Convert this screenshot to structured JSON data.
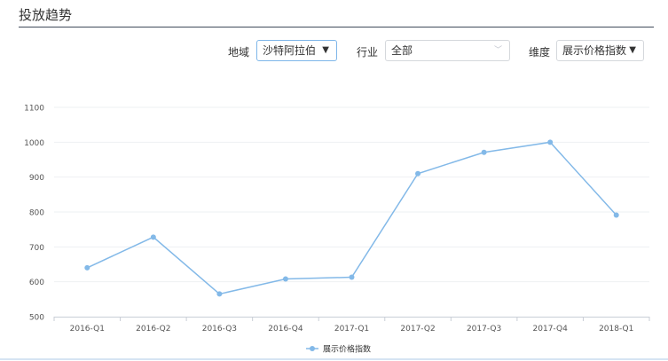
{
  "panel": {
    "title": "投放趋势"
  },
  "filters": {
    "region": {
      "label": "地域",
      "value": "沙特阿拉伯"
    },
    "industry": {
      "label": "行业",
      "value": "全部"
    },
    "dimension": {
      "label": "维度",
      "value": "展示价格指数"
    }
  },
  "chart_data": {
    "type": "line",
    "categories": [
      "2016-Q1",
      "2016-Q2",
      "2016-Q3",
      "2016-Q4",
      "2017-Q1",
      "2017-Q2",
      "2017-Q3",
      "2017-Q4",
      "2018-Q1"
    ],
    "series": [
      {
        "name": "展示价格指数",
        "values": [
          640,
          728,
          565,
          608,
          613,
          910,
          971,
          1000,
          791
        ],
        "color": "#83b9e8"
      }
    ],
    "yticks": [
      500,
      600,
      700,
      800,
      900,
      1000,
      1100
    ],
    "ylim": [
      500,
      1100
    ],
    "grid": true,
    "legend": "bottom-center"
  }
}
